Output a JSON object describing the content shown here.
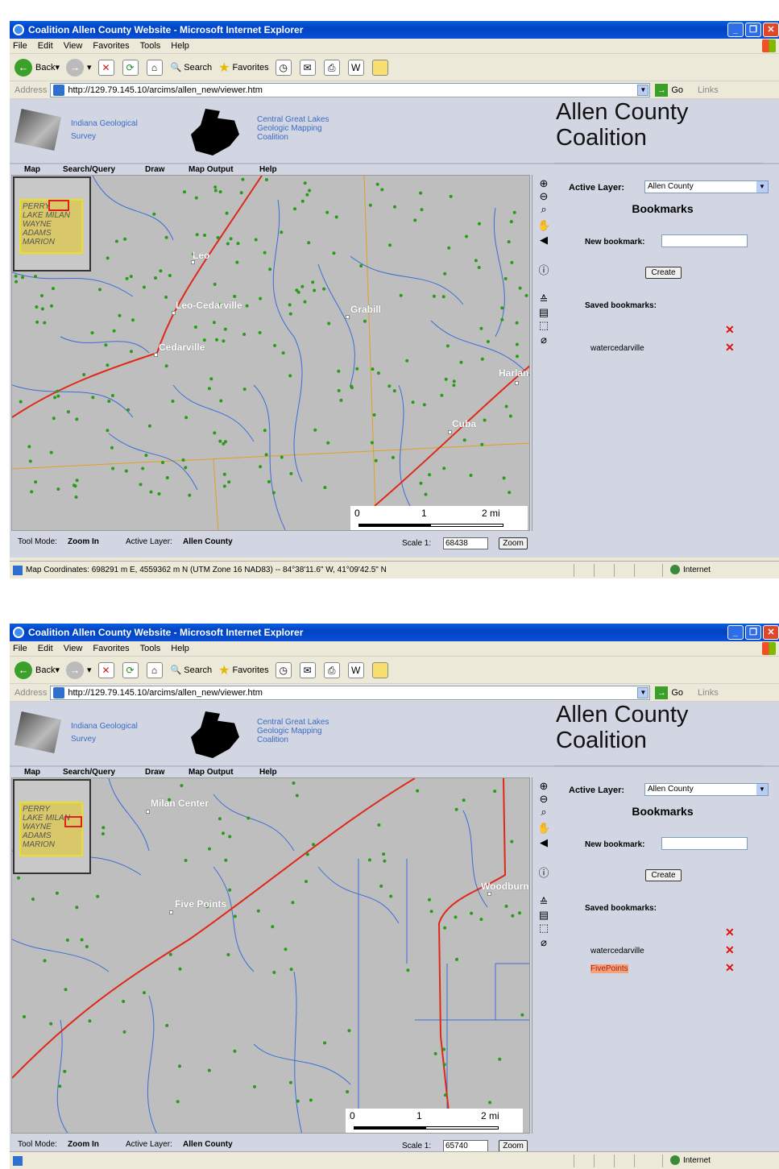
{
  "browser": {
    "title": "Coalition Allen County Website - Microsoft Internet Explorer",
    "menu": [
      "File",
      "Edit",
      "View",
      "Favorites",
      "Tools",
      "Help"
    ],
    "toolbar": {
      "back": "Back",
      "search": "Search",
      "favorites": "Favorites"
    },
    "address_label": "Address",
    "url": "http://129.79.145.10/arcims/allen_new/viewer.htm",
    "go": "Go",
    "links": "Links"
  },
  "header": {
    "igs_line1": "Indiana Geological",
    "igs_line2": "Survey",
    "cgl_line1": "Central Great Lakes",
    "cgl_line2": "Geologic Mapping",
    "cgl_line3": "Coalition",
    "title_line1": "Allen County",
    "title_line2": "Coalition"
  },
  "app_menu": [
    "Map",
    "Search/Query",
    "Draw",
    "Map Output",
    "Help"
  ],
  "overview_labels": [
    "PERRY",
    "LAKE MILAN",
    "WAYNE",
    "ADAMS",
    "MARION"
  ],
  "scale_labels": {
    "zero": "0",
    "one": "1",
    "two": "2 mi"
  },
  "status": {
    "tool_mode_label": "Tool Mode:",
    "tool_mode_value": "Zoom In",
    "active_layer_label": "Active Layer:",
    "active_layer_value": "Allen County",
    "scale_label": "Scale 1:",
    "zoom_button": "Zoom"
  },
  "panel": {
    "active_layer_label": "Active Layer:",
    "active_layer_value": "Allen County",
    "bookmarks_title": "Bookmarks",
    "new_bookmark_label": "New bookmark:",
    "create_button": "Create",
    "saved_label": "Saved bookmarks:"
  },
  "window1": {
    "towns": [
      "Leo",
      "Leo-Cedarville",
      "Cedarville",
      "Grabill",
      "Harlan",
      "Cuba"
    ],
    "scale_value": "68438",
    "bookmarks": [
      "watercedarville"
    ],
    "map_coordinates": "Map Coordinates: 698291 m E, 4559362 m N (UTM Zone 16 NAD83) -- 84°38'11.6\" W, 41°09'42.5\" N",
    "zone": "Internet"
  },
  "window2": {
    "towns": [
      "Milan Center",
      "Five Points",
      "Woodburn"
    ],
    "scale_value": "65740",
    "bookmarks": [
      "watercedarville",
      "FivePoints"
    ],
    "zone": "Internet"
  },
  "colors": {
    "road": "#e02818",
    "stream": "#3a6ed8",
    "section_line": "#e0a020",
    "well": "#2a9a1a",
    "map_bg": "#bebebe"
  }
}
